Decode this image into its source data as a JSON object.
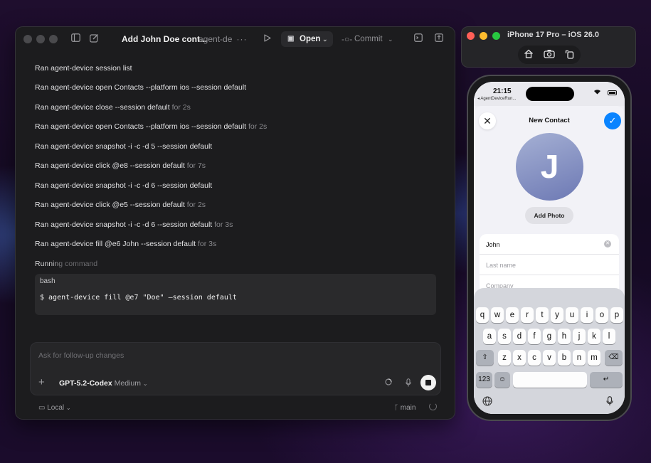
{
  "app": {
    "window_title": "Add John Doe cont...",
    "window_subtitle": "agent-de",
    "more_icon": "ellipsis-icon",
    "open_label": "Open",
    "commit_label": "Commit",
    "log_lines": [
      {
        "cmd": "Ran agent-device session list",
        "dur": ""
      },
      {
        "cmd": "Ran agent-device open Contacts --platform ios --session default",
        "dur": ""
      },
      {
        "cmd": "Ran agent-device close --session default",
        "dur": "for 2s"
      },
      {
        "cmd": "Ran agent-device open Contacts --platform ios --session default",
        "dur": "for 2s"
      },
      {
        "cmd": "Ran agent-device snapshot -i -c -d 5 --session default",
        "dur": ""
      },
      {
        "cmd": "Ran agent-device click @e8 --session default",
        "dur": "for 7s"
      },
      {
        "cmd": "Ran agent-device snapshot -i -c -d 6 --session default",
        "dur": ""
      },
      {
        "cmd": "Ran agent-device click @e5 --session default",
        "dur": "for 2s"
      },
      {
        "cmd": "Ran agent-device snapshot -i -c -d 6 --session default",
        "dur": "for 3s"
      },
      {
        "cmd": "Ran agent-device fill @e6 John --session default",
        "dur": "for 3s"
      }
    ],
    "running_label": "Running command",
    "bash": {
      "label": "bash",
      "command": "$ agent-device fill @e7 \"Doe\" —session default"
    },
    "composer": {
      "placeholder": "Ask for follow-up changes",
      "model_name": "GPT-5.2-Codex",
      "model_effort": "Medium"
    },
    "footer": {
      "environment": "Local",
      "branch": "main"
    }
  },
  "simulator": {
    "title": "iPhone 17 Pro – iOS 26.0",
    "status_time": "21:15",
    "back_app": "◂ AgentDeviceRun...",
    "nav_title": "New Contact",
    "avatar_letter": "J",
    "add_photo_label": "Add Photo",
    "fields": {
      "first_name": "John",
      "last_name_placeholder": "Last name",
      "company_placeholder": "Company"
    },
    "keyboard": {
      "row1": [
        "q",
        "w",
        "e",
        "r",
        "t",
        "y",
        "u",
        "i",
        "o",
        "p"
      ],
      "row2": [
        "a",
        "s",
        "d",
        "f",
        "g",
        "h",
        "j",
        "k",
        "l"
      ],
      "row3": [
        "z",
        "x",
        "c",
        "v",
        "b",
        "n",
        "m"
      ],
      "numbers_key": "123",
      "shift_glyph": "⇧",
      "delete_glyph": "⌫",
      "return_glyph": "↵",
      "emoji_glyph": "☺"
    }
  }
}
